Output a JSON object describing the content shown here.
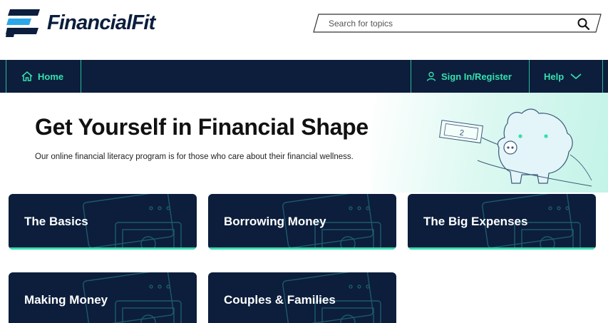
{
  "brand": {
    "name": "FinancialFit",
    "accent": "#35e0ad",
    "navy": "#0c1e3c"
  },
  "search": {
    "placeholder": "Search for topics",
    "icon": "search-icon"
  },
  "nav": {
    "home": {
      "label": "Home",
      "icon": "home-icon"
    },
    "signin": {
      "label": "Sign In/Register",
      "icon": "user-icon"
    },
    "help": {
      "label": "Help",
      "icon": "chevron-down-icon"
    }
  },
  "hero": {
    "title": "Get Yourself in Financial Shape",
    "description": "Our online financial literacy program is for those who care about their financial wellness.",
    "illustration": "piggy-bank-illustration"
  },
  "cards": [
    {
      "label": "The Basics"
    },
    {
      "label": "Borrowing Money"
    },
    {
      "label": "The Big Expenses"
    },
    {
      "label": "Making Money"
    },
    {
      "label": "Couples & Families"
    }
  ]
}
